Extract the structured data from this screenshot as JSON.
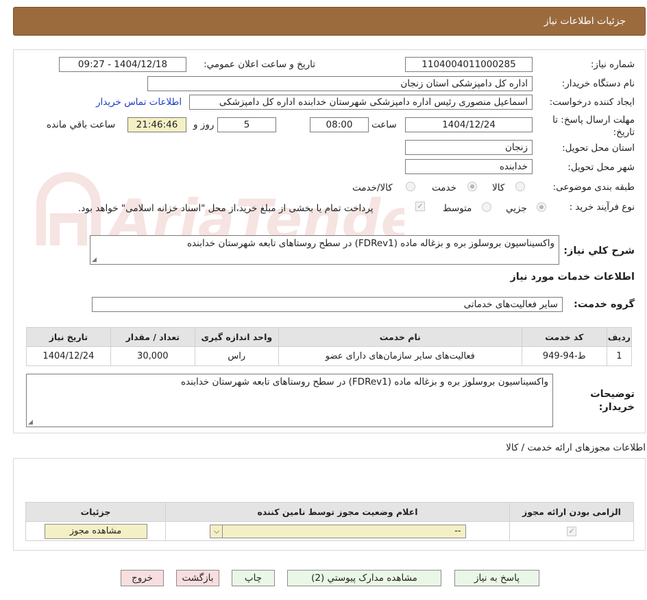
{
  "header": {
    "title": "جزئیات اطلاعات نیاز"
  },
  "watermark": {
    "text": "AriaTender.neT",
    "color": "#c0392b"
  },
  "form": {
    "need_number": {
      "label": "شماره نیاز:",
      "value": "1104004011000285"
    },
    "announce_date": {
      "label": "تاریخ و ساعت اعلان عمومي:",
      "value": "1404/12/18 - 09:27"
    },
    "buyer_org": {
      "label": "نام دستگاه خریدار:",
      "value": "اداره کل دامپزشکی استان زنجان"
    },
    "requester": {
      "label": "ایجاد کننده درخواست:",
      "value": "اسماعیل منصوری رئیس اداره دامپزشکی شهرستان خدابنده اداره کل دامپزشکی",
      "contact_link": "اطلاعات تماس خریدار"
    },
    "deadline": {
      "label": "مهلت ارسال پاسخ: تا تاریخ:",
      "date": "1404/12/24",
      "time_label": "ساعت",
      "time": "08:00",
      "days": "5",
      "days_label": "روز و",
      "remaining": "21:46:46",
      "remaining_label": "ساعت باقي مانده"
    },
    "province": {
      "label": "استان محل تحویل:",
      "value": "زنجان"
    },
    "city": {
      "label": "شهر محل تحویل:",
      "value": "خدابنده"
    },
    "category": {
      "label": "طبقه بندی موضوعی:",
      "options": [
        "کالا",
        "خدمت",
        "کالا/خدمت"
      ],
      "selected": "خدمت"
    },
    "process": {
      "label": "نوع فرآیند خرید :",
      "options": [
        "جزيي",
        "متوسط"
      ],
      "selected": "جزيي",
      "payment_note": "پرداخت تمام یا بخشی از مبلغ خرید،از محل \"اسناد خزانه اسلامی\" خواهد بود."
    },
    "summary": {
      "label": "شرح کلي نیاز:",
      "value": "واکسیناسیون بروسلوز بره و بزغاله ماده (FDRev1) در سطح روستاهای تابعه شهرستان خدابنده"
    }
  },
  "services": {
    "heading": "اطلاعات خدمات مورد نیاز",
    "group_label": "گروه خدمت:",
    "group_value": "سایر فعالیت‌های خدماتی",
    "columns": [
      "ردیف",
      "کد خدمت",
      "نام خدمت",
      "واحد اندازه گیری",
      "تعداد / مقدار",
      "تاریخ نیاز"
    ],
    "rows": [
      [
        "1",
        "ط-94-949",
        "فعالیت‌های سایر سازمان‌های دارای عضو",
        "راس",
        "30,000",
        "1404/12/24"
      ]
    ]
  },
  "buyer_notes": {
    "label": "توضیحات خریدار:",
    "value": "واکسیناسیون بروسلوز بره و بزغاله ماده (FDRev1) در سطح روستاهای تابعه شهرستان خدابنده"
  },
  "permits": {
    "heading": "اطلاعات مجوزهای ارائه خدمت / کالا",
    "columns": [
      "الزامی بودن ارائه مجوز",
      "اعلام وضعیت مجوز توسط نامین کننده",
      "جزئیات"
    ],
    "select_value": "--",
    "view_button": "مشاهده مجوز"
  },
  "buttons": {
    "reply": "پاسخ به نیاز",
    "attachments": "مشاهده مدارک پیوستي (2)",
    "print": "چاپ",
    "back": "بازگشت",
    "exit": "خروج"
  }
}
